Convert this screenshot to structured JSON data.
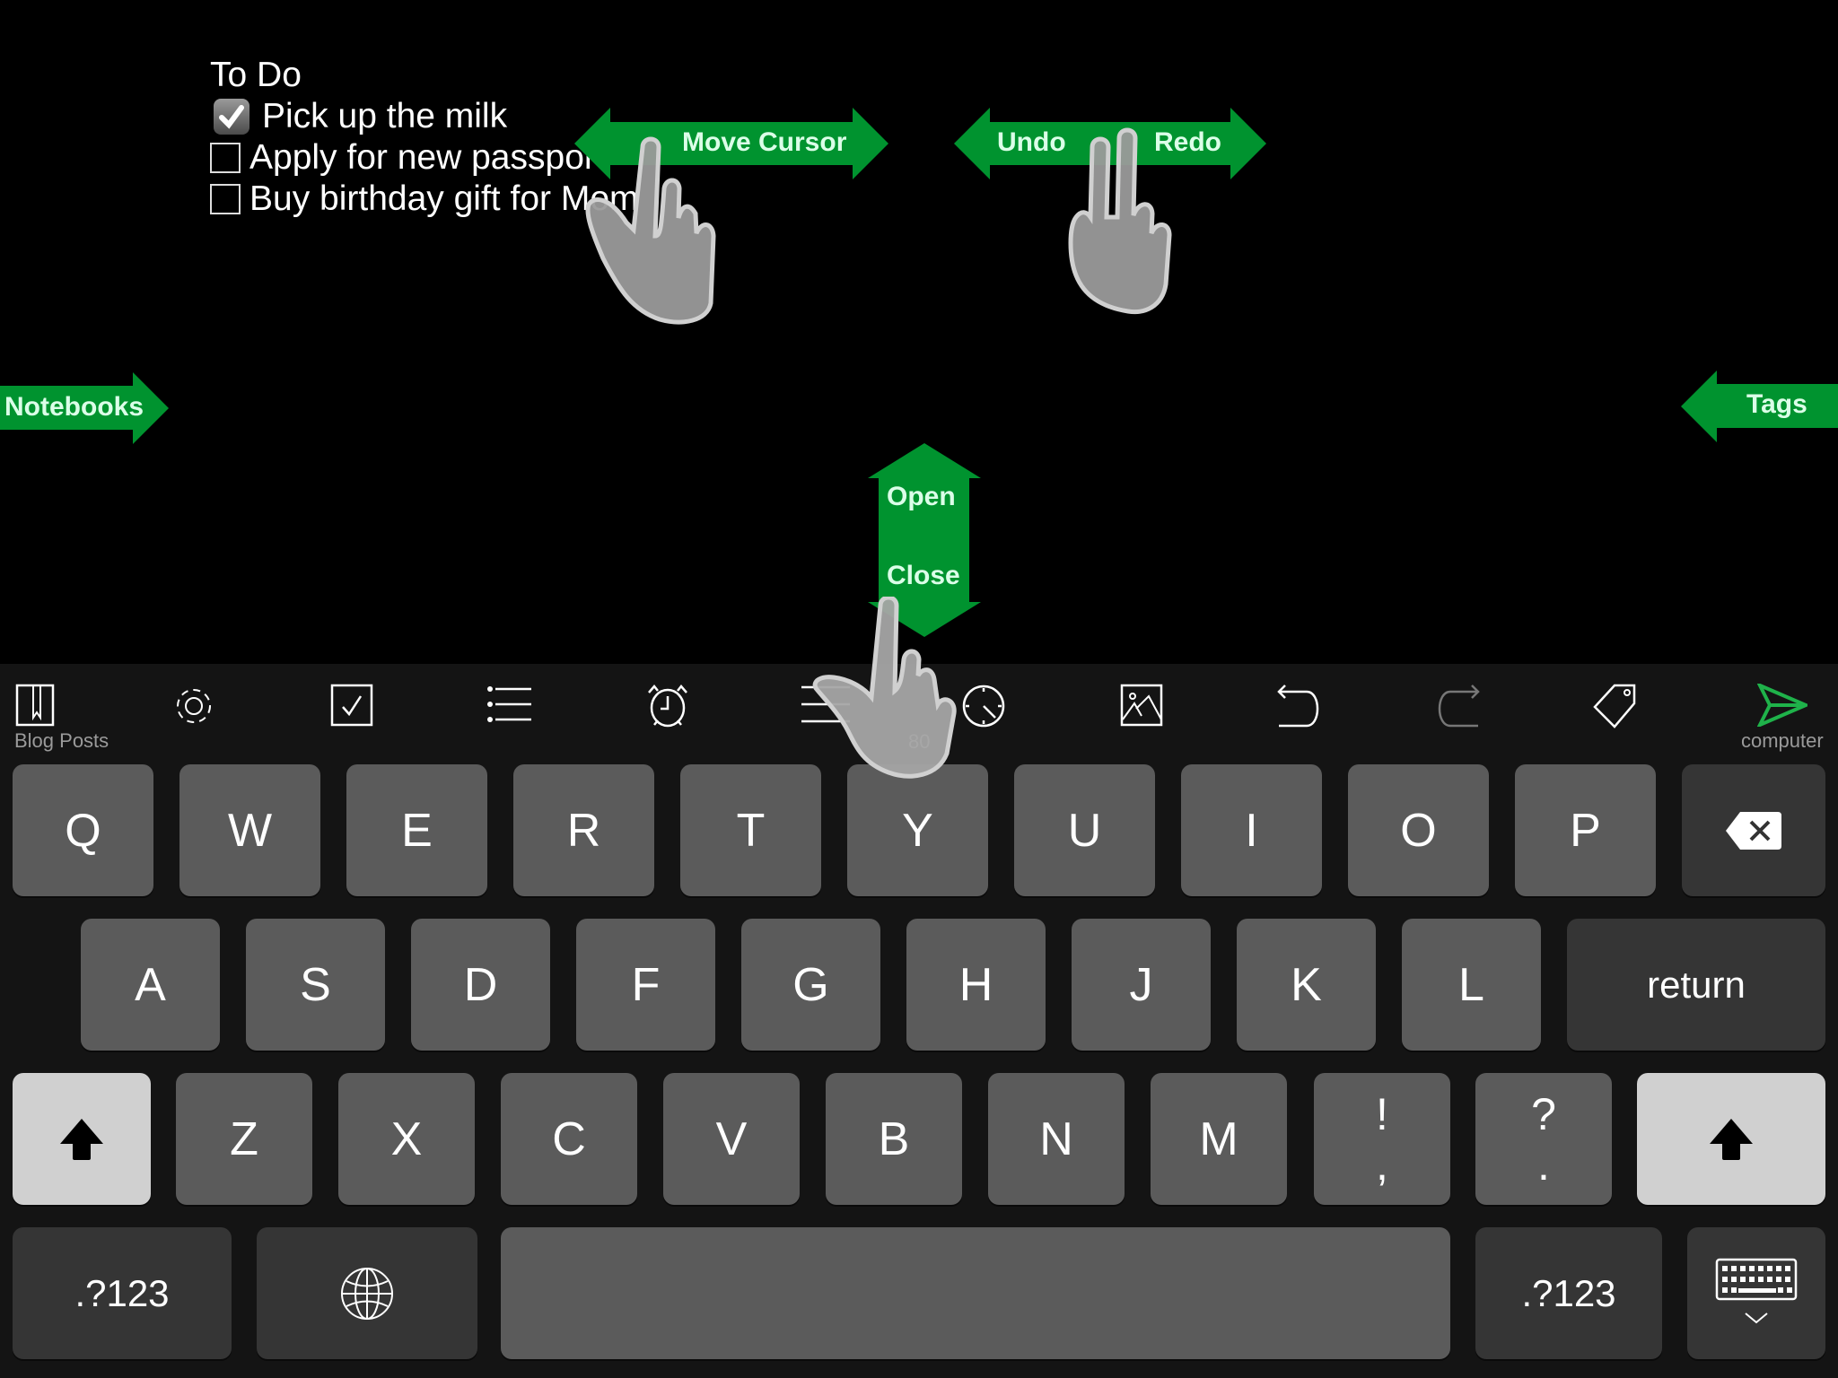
{
  "note": {
    "title": "To Do",
    "items": [
      {
        "label": "Pick up the milk",
        "checked": true
      },
      {
        "label": "Apply for new passport",
        "checked": false
      },
      {
        "label": "Buy birthday gift for Mom",
        "checked": false
      }
    ]
  },
  "gesture_hints": {
    "color": "#00932f",
    "label_color": "#dbffe8",
    "move_cursor": "Move Cursor",
    "undo": "Undo",
    "redo": "Redo",
    "notebooks": "Notebooks",
    "tags": "Tags",
    "open": "Open",
    "close": "Close"
  },
  "toolbar": {
    "notebook_label": "Blog Posts",
    "char_count": "80",
    "send_label": "computer",
    "items": [
      {
        "icon": "notebook-icon"
      },
      {
        "icon": "gear-icon"
      },
      {
        "icon": "checkbox-icon"
      },
      {
        "icon": "bullet-list-icon"
      },
      {
        "icon": "alarm-clock-icon"
      },
      {
        "icon": "text-align-icon"
      },
      {
        "icon": "clock-icon"
      },
      {
        "icon": "image-icon"
      },
      {
        "icon": "undo-icon"
      },
      {
        "icon": "redo-icon"
      },
      {
        "icon": "tag-icon"
      },
      {
        "icon": "send-icon"
      }
    ],
    "accent": "#1fb24a"
  },
  "keyboard": {
    "row1": [
      "Q",
      "W",
      "E",
      "R",
      "T",
      "Y",
      "U",
      "I",
      "O",
      "P"
    ],
    "row2": [
      "A",
      "S",
      "D",
      "F",
      "G",
      "H",
      "J",
      "K",
      "L"
    ],
    "row3": [
      "Z",
      "X",
      "C",
      "V",
      "B",
      "N",
      "M"
    ],
    "punct1": {
      "top": "!",
      "bottom": ","
    },
    "punct2": {
      "top": "?",
      "bottom": "."
    },
    "return_label": "return",
    "numbers_label": ".?123"
  }
}
